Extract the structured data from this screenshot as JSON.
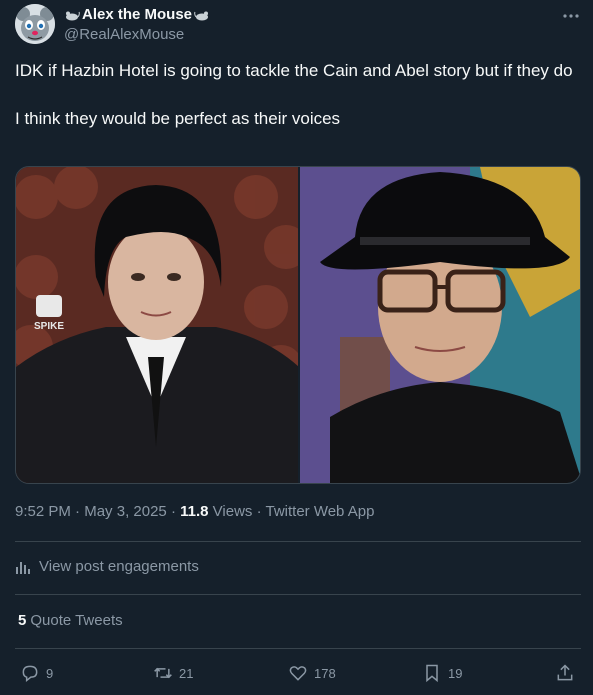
{
  "author": {
    "display_name": "Alex the Mouse",
    "handle": "@RealAlexMouse",
    "avatar_icon": "cartoon-mouse-avatar",
    "name_emoji": "mouse-emoji"
  },
  "more_icon": "more-horizontal-icon",
  "tweet": {
    "text": "IDK if Hazbin Hotel is going to tackle the Cain and Abel story but if they do\n\nI think they would be perfect as their voices",
    "media": [
      {
        "name": "photo-left",
        "description_icon": "photo"
      },
      {
        "name": "photo-right",
        "description_icon": "photo"
      }
    ],
    "media_logo_text": "SPIKE"
  },
  "meta": {
    "time": "9:52 PM",
    "sep1": " · ",
    "date": "May 3, 2025",
    "sep2": " · ",
    "views_count": "11.8",
    "views_label": " Views",
    "sep3": " · ",
    "source": "Twitter Web App"
  },
  "engagements": {
    "label": "View post engagements",
    "icon": "bar-chart-icon"
  },
  "quotes": {
    "count": "5",
    "label": "Quote Tweets"
  },
  "actions": {
    "reply": {
      "count": "9",
      "icon": "reply-icon"
    },
    "retweet": {
      "count": "21",
      "icon": "retweet-icon"
    },
    "like": {
      "count": "178",
      "icon": "heart-icon"
    },
    "bookmark": {
      "count": "19",
      "icon": "bookmark-icon"
    },
    "share": {
      "icon": "share-icon"
    }
  },
  "colors": {
    "background": "#15202b",
    "text": "#f7f9f9",
    "secondary": "#8b98a5",
    "divider": "#38444d"
  }
}
